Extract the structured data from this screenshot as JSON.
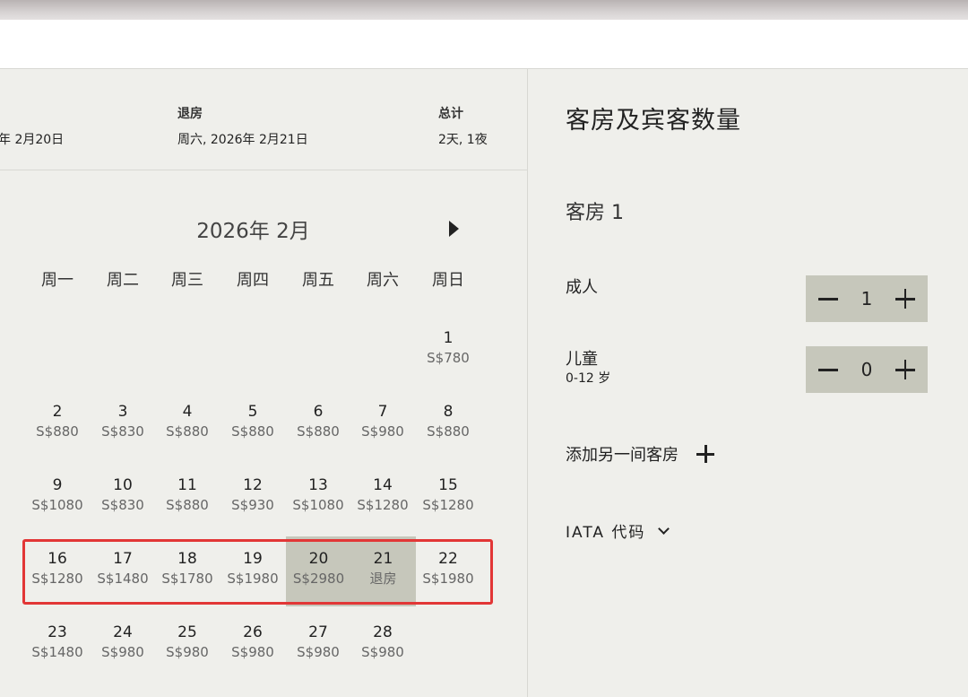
{
  "summary": {
    "checkin_value": "年 2月20日",
    "checkout_label": "退房",
    "checkout_value": "周六, 2026年 2月21日",
    "total_label": "总计",
    "total_value": "2天, 1夜"
  },
  "calendar": {
    "month_title": "2026年 2月",
    "weekdays": [
      "周一",
      "周二",
      "周三",
      "周四",
      "周五",
      "周六",
      "周日"
    ],
    "days": [
      {
        "num": "1",
        "price": "S$780"
      },
      {
        "num": "2",
        "price": "S$880"
      },
      {
        "num": "3",
        "price": "S$830"
      },
      {
        "num": "4",
        "price": "S$880"
      },
      {
        "num": "5",
        "price": "S$880"
      },
      {
        "num": "6",
        "price": "S$880"
      },
      {
        "num": "7",
        "price": "S$980"
      },
      {
        "num": "8",
        "price": "S$880"
      },
      {
        "num": "9",
        "price": "S$1080"
      },
      {
        "num": "10",
        "price": "S$830"
      },
      {
        "num": "11",
        "price": "S$880"
      },
      {
        "num": "12",
        "price": "S$930"
      },
      {
        "num": "13",
        "price": "S$1080"
      },
      {
        "num": "14",
        "price": "S$1280"
      },
      {
        "num": "15",
        "price": "S$1280"
      },
      {
        "num": "16",
        "price": "S$1280"
      },
      {
        "num": "17",
        "price": "S$1480"
      },
      {
        "num": "18",
        "price": "S$1780"
      },
      {
        "num": "19",
        "price": "S$1980"
      },
      {
        "num": "20",
        "price": "S$2980"
      },
      {
        "num": "21",
        "price": "退房"
      },
      {
        "num": "22",
        "price": "S$1980"
      },
      {
        "num": "23",
        "price": "S$1480"
      },
      {
        "num": "24",
        "price": "S$980"
      },
      {
        "num": "25",
        "price": "S$980"
      },
      {
        "num": "26",
        "price": "S$980"
      },
      {
        "num": "27",
        "price": "S$980"
      },
      {
        "num": "28",
        "price": "S$980"
      }
    ]
  },
  "guests": {
    "title": "客房及宾客数量",
    "room_title": "客房 1",
    "adults_label": "成人",
    "adults_value": "1",
    "children_label": "儿童",
    "children_sub": "0-12 岁",
    "children_value": "0",
    "add_room_label": "添加另一间客房",
    "iata_label": "IATA 代码"
  }
}
